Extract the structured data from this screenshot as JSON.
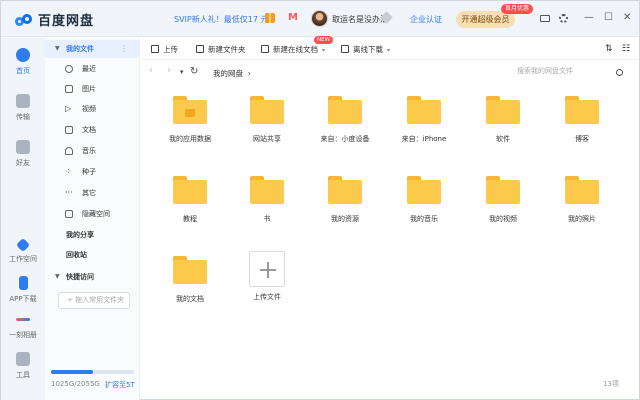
{
  "app": {
    "name": "百度网盘"
  },
  "titlebar": {
    "promo": "SVIP新人礼！最低仅17 元",
    "username": "取运名是没办法",
    "enterprise": "企业认证",
    "super_button": "开通超级会员",
    "first_month_badge": "首月优惠"
  },
  "leftnav": [
    {
      "label": "首页",
      "icon": "home-icon",
      "active": true
    },
    {
      "label": "传输",
      "icon": "transfer-icon",
      "active": false
    },
    {
      "label": "好友",
      "icon": "friends-icon",
      "active": false
    },
    {
      "label": "工作空间",
      "icon": "workspace-icon",
      "active": false
    },
    {
      "label": "APP下载",
      "icon": "phone-icon",
      "active": false
    },
    {
      "label": "一刻相册",
      "icon": "album-icon",
      "active": false
    },
    {
      "label": "工具",
      "icon": "tools-icon",
      "active": false
    }
  ],
  "sidebar": {
    "my_files": "我的文件",
    "items": [
      {
        "label": "最近",
        "icon": "clock-icon"
      },
      {
        "label": "图片",
        "icon": "image-icon"
      },
      {
        "label": "视频",
        "icon": "video-icon"
      },
      {
        "label": "文档",
        "icon": "document-icon"
      },
      {
        "label": "音乐",
        "icon": "music-icon"
      },
      {
        "label": "种子",
        "icon": "seed-icon"
      },
      {
        "label": "其它",
        "icon": "other-icon"
      },
      {
        "label": "隐藏空间",
        "icon": "hidden-space-icon"
      }
    ],
    "my_share": "我的分享",
    "recycle": "回收站",
    "quick_access": "快捷访问",
    "add_quick": "+ 拖入常用文件夹",
    "quota_text": "1025G/2055G",
    "quota_fraction": 0.5,
    "expand": "扩容至5T"
  },
  "toolbar": {
    "upload": "上传",
    "new_folder": "新建文件夹",
    "new_online_doc": "新建在线文档",
    "new_badge": "NEW",
    "offline_download": "离线下载"
  },
  "address": {
    "breadcrumb": "我的网盘",
    "search_placeholder": "搜索我的网盘文件"
  },
  "folders": [
    "我的应用数据",
    "网站共享",
    "来自：小度设备",
    "来自：iPhone",
    "软件",
    "博客",
    "教程",
    "书",
    "我的资源",
    "我的音乐",
    "我的视频",
    "我的照片",
    "我的文档"
  ],
  "upload_tile": "上传文件",
  "status": {
    "count": "13项"
  }
}
